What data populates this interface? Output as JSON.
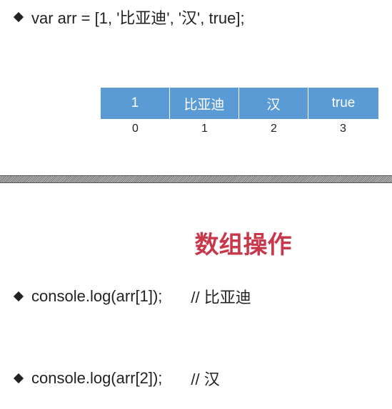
{
  "top_line": {
    "code": "var arr = [1, '比亚迪', '汉', true];"
  },
  "array": {
    "values": [
      "1",
      "比亚迪",
      "汉",
      "true"
    ],
    "indexes": [
      "0",
      "1",
      "2",
      "3"
    ]
  },
  "section": {
    "title": "数组操作"
  },
  "examples": [
    {
      "code": "console.log(arr[1]);",
      "comment": "// 比亚迪"
    },
    {
      "code": "console.log(arr[2]);",
      "comment": "// 汉"
    }
  ],
  "colors": {
    "cell_bg": "#5b9bd5",
    "title": "#c8374a"
  }
}
